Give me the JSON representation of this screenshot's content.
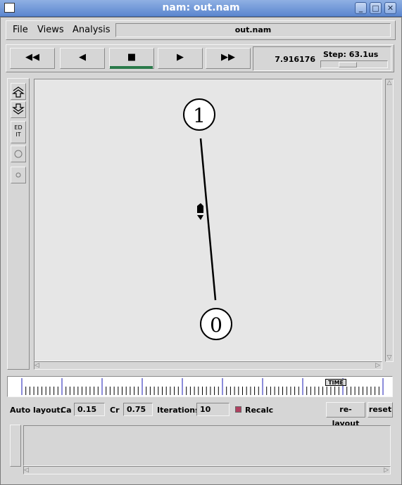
{
  "window": {
    "title": "nam: out.nam",
    "buttons": [
      "_",
      "□",
      "✕"
    ]
  },
  "menu": {
    "file": "File",
    "views": "Views",
    "analysis": "Analysis",
    "filename": "out.nam"
  },
  "controls": {
    "rewind": "◀◀",
    "back": "◀",
    "stop": "■",
    "play": "▶",
    "fastforward": "▶▶"
  },
  "time": {
    "value": "7.916176",
    "step_label": "Step: 63.1us"
  },
  "tools": {
    "edit": "ED\nIT"
  },
  "network": {
    "nodes": [
      {
        "id": "node-1",
        "label": "1"
      },
      {
        "id": "node-0",
        "label": "0"
      }
    ]
  },
  "timeline": {
    "label": "TIME"
  },
  "layout": {
    "auto_layout_label": "Auto layout:",
    "ca_label": "Ca",
    "ca_value": "0.15",
    "cr_label": "Cr",
    "cr_value": "0.75",
    "iterations_label": "Iterations",
    "iterations_value": "10",
    "recalc_label": "Recalc",
    "recalc_checked": true,
    "relayout_button": "re-layout",
    "reset_button": "reset"
  },
  "colors": {
    "titlebar": "#5b86cf",
    "canvas": "#e6e6e6",
    "timeline_major_tick": "#1a1ab5",
    "play_indicator": "#2a7a4a"
  }
}
